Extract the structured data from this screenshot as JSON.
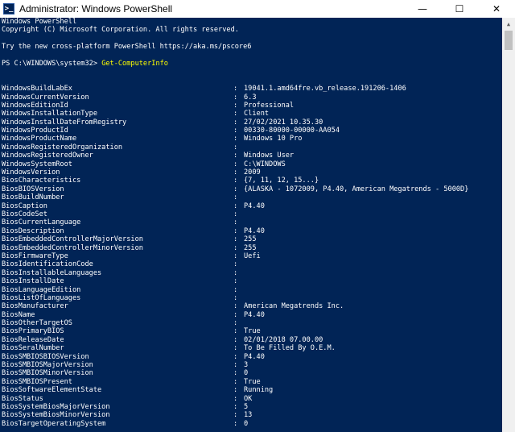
{
  "window": {
    "title": "Administrator: Windows PowerShell",
    "icon_label": ">_",
    "minimize": "—",
    "maximize": "☐",
    "close": "✕"
  },
  "console": {
    "header": [
      "Windows PowerShell",
      "Copyright (C) Microsoft Corporation. All rights reserved.",
      "",
      "Try the new cross-platform PowerShell https://aka.ms/pscore6",
      ""
    ],
    "prompt": "PS C:\\WINDOWS\\system32> ",
    "command": "Get-ComputerInfo",
    "separator": ":",
    "properties": [
      {
        "name": "WindowsBuildLabEx",
        "value": "19041.1.amd64fre.vb_release.191206-1406"
      },
      {
        "name": "WindowsCurrentVersion",
        "value": "6.3"
      },
      {
        "name": "WindowsEditionId",
        "value": "Professional"
      },
      {
        "name": "WindowsInstallationType",
        "value": "Client"
      },
      {
        "name": "WindowsInstallDateFromRegistry",
        "value": "27/02/2021 10.35.30"
      },
      {
        "name": "WindowsProductId",
        "value": "00330-80000-00000-AA054"
      },
      {
        "name": "WindowsProductName",
        "value": "Windows 10 Pro"
      },
      {
        "name": "WindowsRegisteredOrganization",
        "value": ""
      },
      {
        "name": "WindowsRegisteredOwner",
        "value": "Windows User"
      },
      {
        "name": "WindowsSystemRoot",
        "value": "C:\\WINDOWS"
      },
      {
        "name": "WindowsVersion",
        "value": "2009"
      },
      {
        "name": "BiosCharacteristics",
        "value": "{7, 11, 12, 15...}"
      },
      {
        "name": "BiosBIOSVersion",
        "value": "{ALASKA - 1072009, P4.40, American Megatrends - 5000D}"
      },
      {
        "name": "BiosBuildNumber",
        "value": ""
      },
      {
        "name": "BiosCaption",
        "value": "P4.40"
      },
      {
        "name": "BiosCodeSet",
        "value": ""
      },
      {
        "name": "BiosCurrentLanguage",
        "value": ""
      },
      {
        "name": "BiosDescription",
        "value": "P4.40"
      },
      {
        "name": "BiosEmbeddedControllerMajorVersion",
        "value": "255"
      },
      {
        "name": "BiosEmbeddedControllerMinorVersion",
        "value": "255"
      },
      {
        "name": "BiosFirmwareType",
        "value": "Uefi"
      },
      {
        "name": "BiosIdentificationCode",
        "value": ""
      },
      {
        "name": "BiosInstallableLanguages",
        "value": ""
      },
      {
        "name": "BiosInstallDate",
        "value": ""
      },
      {
        "name": "BiosLanguageEdition",
        "value": ""
      },
      {
        "name": "BiosListOfLanguages",
        "value": ""
      },
      {
        "name": "BiosManufacturer",
        "value": "American Megatrends Inc."
      },
      {
        "name": "BiosName",
        "value": "P4.40"
      },
      {
        "name": "BiosOtherTargetOS",
        "value": ""
      },
      {
        "name": "BiosPrimaryBIOS",
        "value": "True"
      },
      {
        "name": "BiosReleaseDate",
        "value": "02/01/2018 07.00.00"
      },
      {
        "name": "BiosSeralNumber",
        "value": "To Be Filled By O.E.M."
      },
      {
        "name": "BiosSMBIOSBIOSVersion",
        "value": "P4.40"
      },
      {
        "name": "BiosSMBIOSMajorVersion",
        "value": "3"
      },
      {
        "name": "BiosSMBIOSMinorVersion",
        "value": "0"
      },
      {
        "name": "BiosSMBIOSPresent",
        "value": "True"
      },
      {
        "name": "BiosSoftwareElementState",
        "value": "Running"
      },
      {
        "name": "BiosStatus",
        "value": "OK"
      },
      {
        "name": "BiosSystemBiosMajorVersion",
        "value": "5"
      },
      {
        "name": "BiosSystemBiosMinorVersion",
        "value": "13"
      },
      {
        "name": "BiosTargetOperatingSystem",
        "value": "0"
      }
    ]
  },
  "scrollbar": {
    "up_arrow": "▲"
  },
  "colors": {
    "background": "#012456",
    "text": "#ffffff",
    "command": "#ffff00"
  }
}
